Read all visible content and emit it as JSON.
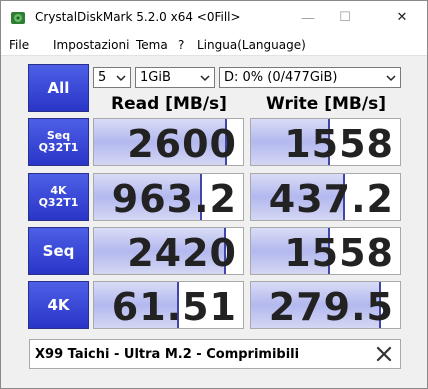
{
  "window": {
    "title": "CrystalDiskMark 5.2.0 x64 <0Fill>",
    "minimize_glyph": "—",
    "maximize_glyph": "☐",
    "close_glyph": "✕"
  },
  "menu": {
    "items": [
      "File",
      "Impostazioni",
      "Tema",
      "?",
      "Lingua(Language)"
    ]
  },
  "controls": {
    "all_label": "All",
    "count_value": "5",
    "size_value": "1GiB",
    "drive_value": "D: 0% (0/477GiB)"
  },
  "headers": {
    "read": "Read [MB/s]",
    "write": "Write [MB/s]"
  },
  "tests": [
    {
      "label_line1": "Seq",
      "label_line2": "Q32T1",
      "read": "2600",
      "write": "1558",
      "read_fill": 0.88,
      "write_fill": 0.52
    },
    {
      "label_line1": "4K",
      "label_line2": "Q32T1",
      "read": "963.2",
      "write": "437.2",
      "read_fill": 0.71,
      "write_fill": 0.62
    },
    {
      "label_line1": "Seq",
      "label_line2": "",
      "read": "2420",
      "write": "1558",
      "read_fill": 0.87,
      "write_fill": 0.52
    },
    {
      "label_line1": "4K",
      "label_line2": "",
      "read": "61.51",
      "write": "279.5",
      "read_fill": 0.56,
      "write_fill": 0.86
    }
  ],
  "comment": {
    "text": "X99 Taichi - Ultra M.2 - Comprimibili"
  },
  "colors": {
    "button_blue": "#3541d6",
    "bar_fill": "#b3b8ef",
    "bar_edge": "#3f46a8"
  },
  "icons": {
    "app": "disk-icon",
    "dropdown": "chevron-down-icon",
    "clear": "close-icon"
  }
}
